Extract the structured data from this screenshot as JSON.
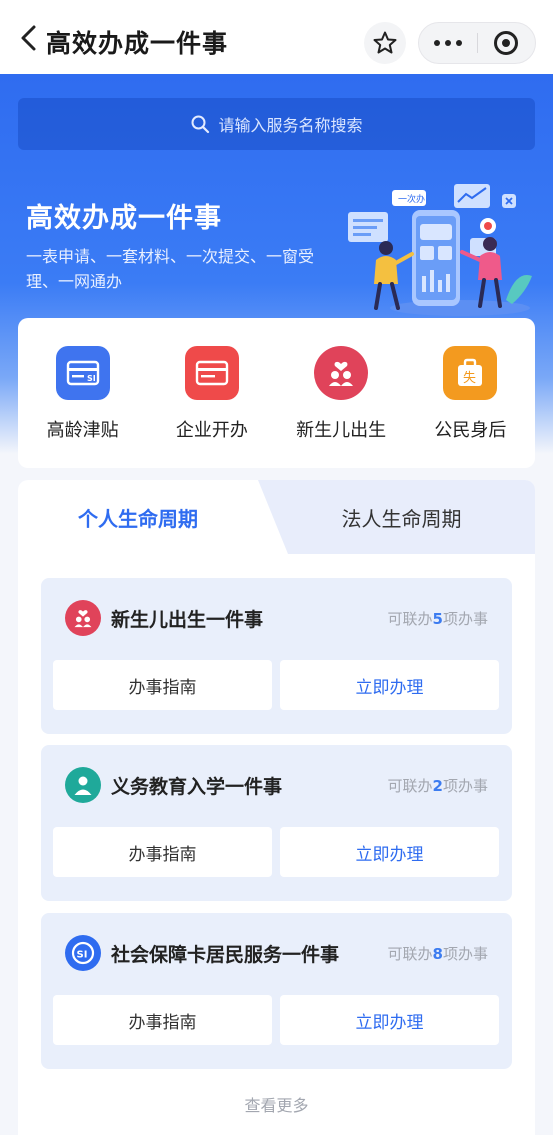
{
  "nav": {
    "title": "高效办成一件事"
  },
  "search": {
    "placeholder": "请输入服务名称搜索"
  },
  "hero": {
    "title": "高效办成一件事",
    "desc": "一表申请、一套材料、一次提交、一窗受理、一网通办",
    "art_tag": "一次办"
  },
  "quick_services": [
    {
      "label": "高龄津贴",
      "icon": "si-card-icon",
      "color": "#3f74ef"
    },
    {
      "label": "企业开办",
      "icon": "card-icon",
      "color": "#ef4a4a"
    },
    {
      "label": "新生儿出生",
      "icon": "family-icon",
      "color": "#e0435a"
    },
    {
      "label": "公民身后",
      "icon": "bag-icon",
      "color": "#f39a1f"
    }
  ],
  "tabs": {
    "personal": "个人生命周期",
    "legal": "法人生命周期"
  },
  "life_items": [
    {
      "title": "新生儿出生一件事",
      "count_prefix": "可联办",
      "count": "5",
      "count_suffix": "项办事",
      "icon": "family-icon",
      "icon_color": "#e0435a",
      "guide": "办事指南",
      "apply": "立即办理"
    },
    {
      "title": "义务教育入学一件事",
      "count_prefix": "可联办",
      "count": "2",
      "count_suffix": "项办事",
      "icon": "student-icon",
      "icon_color": "#1fa99a",
      "guide": "办事指南",
      "apply": "立即办理"
    },
    {
      "title": "社会保障卡居民服务一件事",
      "count_prefix": "可联办",
      "count": "8",
      "count_suffix": "项办事",
      "icon": "social-security-icon",
      "icon_color": "#2f6cf0",
      "guide": "办事指南",
      "apply": "立即办理"
    }
  ],
  "more_label": "查看更多",
  "colors": {
    "primary": "#2f6cf0",
    "card_bg": "#e9effb"
  }
}
